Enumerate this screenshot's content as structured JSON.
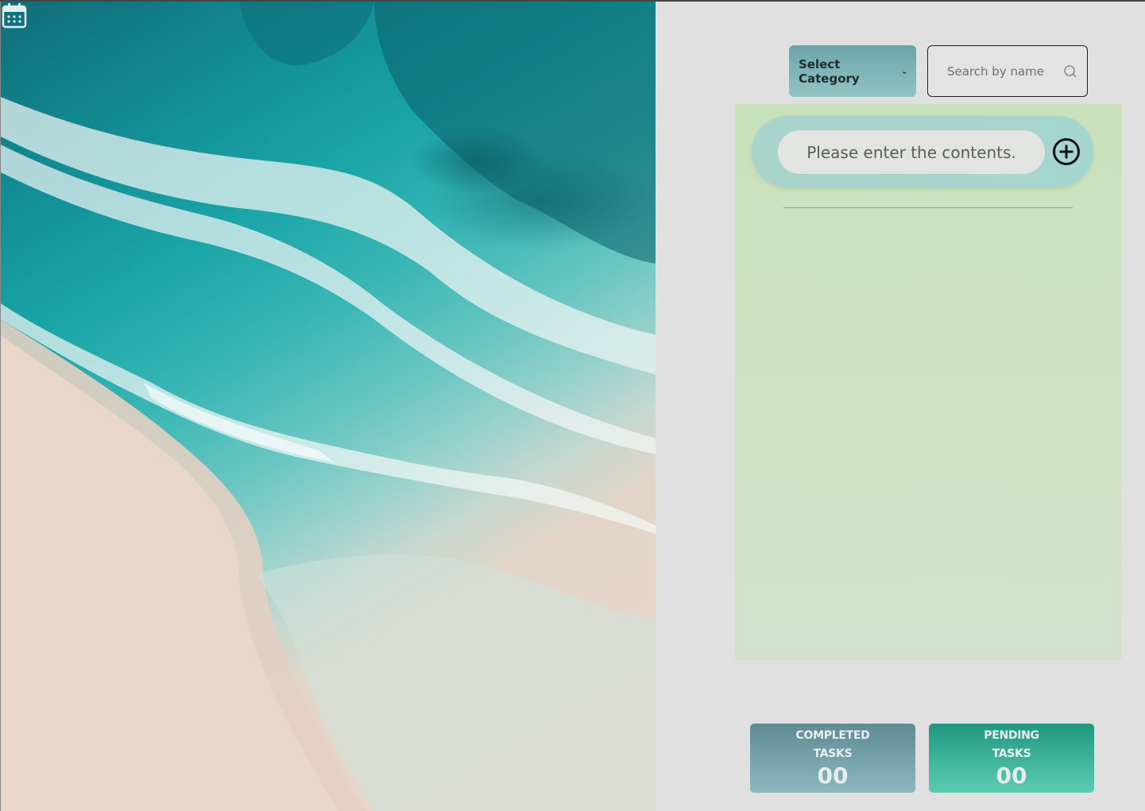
{
  "hero": {
    "image_description_icon": "calendar-icon"
  },
  "toolbar": {
    "category_label": "Select Category",
    "category_chevron": "chevron-down-icon",
    "search_placeholder": "Search by name",
    "search_icon": "search-icon"
  },
  "task_form": {
    "input_placeholder": "Please enter the contents.",
    "add_icon": "plus-circle-icon"
  },
  "stats": {
    "completed_label_line1": "COMPLETED",
    "completed_label_line2": "TASKS",
    "completed_value": "00",
    "pending_label_line1": "PENDING",
    "pending_label_line2": "TASKS",
    "pending_value": "00"
  },
  "colors": {
    "page_background": "#e0e0e0",
    "task_panel": "#c8e2bb",
    "add_bar": "#a8d4cb",
    "completed_card": "#5e8b93",
    "pending_card": "#21967f"
  }
}
